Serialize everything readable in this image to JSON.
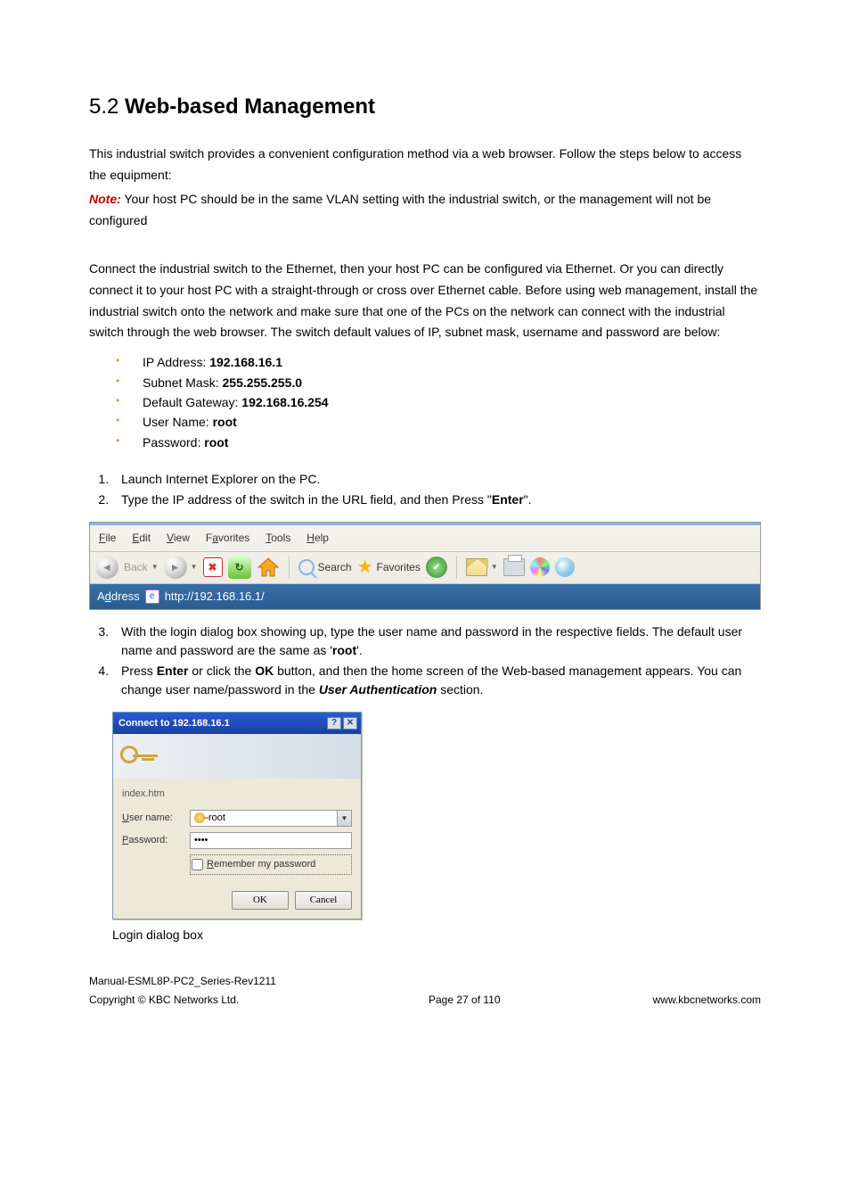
{
  "heading": {
    "number": "5.2",
    "title": "Web-based Management"
  },
  "intro": "This industrial switch provides a convenient configuration method via a web browser. Follow the steps below to access the equipment:",
  "note": {
    "label": "Note:",
    "text": " Your host PC should be in the same VLAN setting with the industrial switch, or the management will not be configured"
  },
  "para2": "Connect the industrial switch to the Ethernet, then your host PC can be configured via Ethernet. Or you can directly connect it to your host PC with a straight-through or cross over Ethernet cable. Before using web management, install the industrial switch onto the network and make sure that one of the PCs on the network can connect with the industrial switch through the web browser. The switch default values of IP, subnet mask, username and password are below:",
  "defaults": [
    {
      "label": "IP Address: ",
      "value": "192.168.16.1"
    },
    {
      "label": "Subnet Mask: ",
      "value": "255.255.255.0"
    },
    {
      "label": "Default Gateway: ",
      "value": "192.168.16.254"
    },
    {
      "label": "User Name: ",
      "value": "root"
    },
    {
      "label": "Password: ",
      "value": "root"
    }
  ],
  "steps_a": [
    {
      "text": "Launch Internet Explorer on the PC."
    },
    {
      "pre": "Type the IP address of the switch in the URL field, and then Press \"",
      "bold": "Enter",
      "post": "\"."
    }
  ],
  "ie": {
    "menu": {
      "file": "File",
      "edit": "Edit",
      "view": "View",
      "favorites": "Favorites",
      "tools": "Tools",
      "help": "Help"
    },
    "back": "Back",
    "search": "Search",
    "favorites_btn": "Favorites",
    "address_label": "Address",
    "address_value": "http://192.168.16.1/"
  },
  "steps_b": [
    {
      "pre": "With the login dialog box showing up, type the user name and password in the respective fields. The default user name and password are the same as '",
      "bold": "root",
      "post": "'."
    },
    {
      "pre": "Press ",
      "bold": "Enter",
      "mid": " or click the ",
      "bold2": "OK",
      "mid2": " button, and then the home screen of the Web-based management appears. You can change user name/password in the ",
      "bolditalic": "User Authentication",
      "post": " section."
    }
  ],
  "dialog": {
    "title": "Connect to 192.168.16.1",
    "realm": "index.htm",
    "user_label": "User name:",
    "user_value": "root",
    "pass_label": "Password:",
    "pass_value": "••••",
    "remember": "Remember my password",
    "ok": "OK",
    "cancel": "Cancel"
  },
  "caption": "Login dialog box",
  "footer": {
    "doc": "Manual-ESML8P-PC2_Series-Rev1211",
    "copyright": "Copyright © KBC Networks Ltd.",
    "page": "Page 27 of 110",
    "url": "www.kbcnetworks.com"
  }
}
